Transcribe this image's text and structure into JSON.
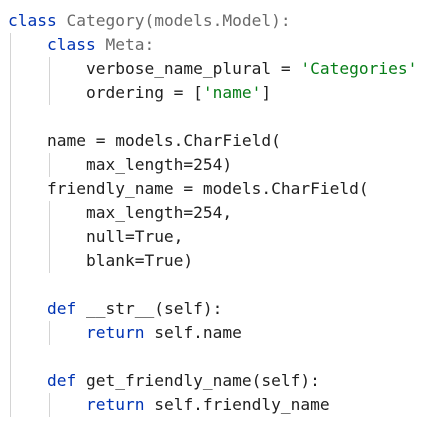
{
  "code": {
    "lines": [
      {
        "indent": "",
        "tokens": [
          {
            "t": "class",
            "k": "kw"
          },
          {
            "t": " ",
            "k": "punct"
          },
          {
            "t": "Category(models.Model):",
            "k": "cls"
          }
        ]
      },
      {
        "indent": "    ",
        "tokens": [
          {
            "t": "class",
            "k": "kw"
          },
          {
            "t": " ",
            "k": "punct"
          },
          {
            "t": "Meta:",
            "k": "cls"
          }
        ]
      },
      {
        "indent": "        ",
        "tokens": [
          {
            "t": "verbose_name_plural = ",
            "k": "name"
          },
          {
            "t": "'Categories'",
            "k": "str"
          }
        ]
      },
      {
        "indent": "        ",
        "tokens": [
          {
            "t": "ordering = [",
            "k": "name"
          },
          {
            "t": "'name'",
            "k": "str"
          },
          {
            "t": "]",
            "k": "name"
          }
        ]
      },
      {
        "indent": "",
        "tokens": []
      },
      {
        "indent": "    ",
        "tokens": [
          {
            "t": "name = models.CharField(",
            "k": "name"
          }
        ]
      },
      {
        "indent": "        ",
        "tokens": [
          {
            "t": "max_length=254)",
            "k": "name"
          }
        ]
      },
      {
        "indent": "    ",
        "tokens": [
          {
            "t": "friendly_name = models.CharField(",
            "k": "name"
          }
        ]
      },
      {
        "indent": "        ",
        "tokens": [
          {
            "t": "max_length=254,",
            "k": "name"
          }
        ]
      },
      {
        "indent": "        ",
        "tokens": [
          {
            "t": "null=True,",
            "k": "name"
          }
        ]
      },
      {
        "indent": "        ",
        "tokens": [
          {
            "t": "blank=True)",
            "k": "name"
          }
        ]
      },
      {
        "indent": "",
        "tokens": []
      },
      {
        "indent": "    ",
        "tokens": [
          {
            "t": "def",
            "k": "kw"
          },
          {
            "t": " ",
            "k": "punct"
          },
          {
            "t": "__str__(self):",
            "k": "name"
          }
        ]
      },
      {
        "indent": "        ",
        "tokens": [
          {
            "t": "return",
            "k": "kw"
          },
          {
            "t": " ",
            "k": "punct"
          },
          {
            "t": "self.name",
            "k": "name"
          }
        ]
      },
      {
        "indent": "",
        "tokens": []
      },
      {
        "indent": "    ",
        "tokens": [
          {
            "t": "def",
            "k": "kw"
          },
          {
            "t": " ",
            "k": "punct"
          },
          {
            "t": "get_friendly_name(self):",
            "k": "name"
          }
        ]
      },
      {
        "indent": "        ",
        "tokens": [
          {
            "t": "return",
            "k": "kw"
          },
          {
            "t": " ",
            "k": "punct"
          },
          {
            "t": "self.friendly_name",
            "k": "name"
          }
        ]
      }
    ]
  },
  "colors": {
    "keyword": "#0033b3",
    "string": "#067d17",
    "class_name": "#6a6a6a",
    "default": "#1f1f1f",
    "indent_guide": "#d4d4d4",
    "background": "#ffffff"
  }
}
